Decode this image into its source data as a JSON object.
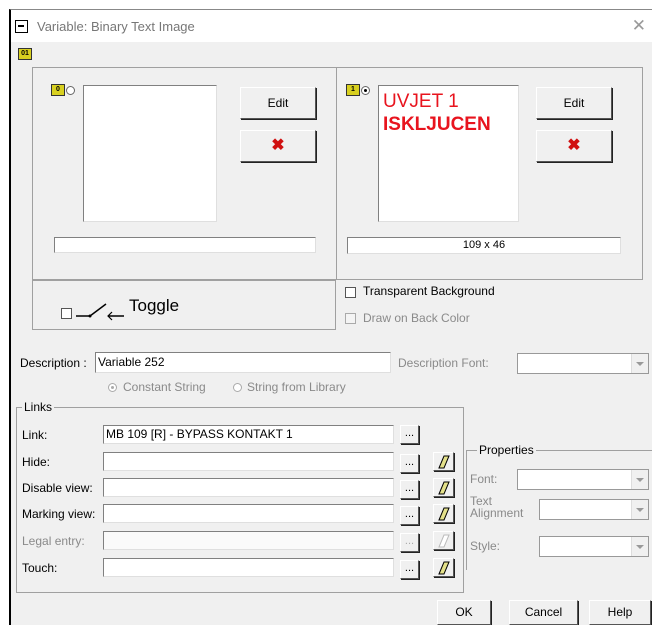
{
  "window": {
    "title": "Variable: Binary Text Image"
  },
  "state0": {
    "badge": "0",
    "edit_label": "Edit",
    "delete_glyph": "✖"
  },
  "state1": {
    "badge": "1",
    "text_lines": [
      "UVJET 1",
      "ISKLJUCEN"
    ],
    "size_text": "109 x 46",
    "edit_label": "Edit",
    "delete_glyph": "✖",
    "text_color": "#e8141e"
  },
  "toggle": {
    "label": "Toggle"
  },
  "options": {
    "transparent_bg": "Transparent Background",
    "draw_on_back_color": "Draw on Back Color"
  },
  "description": {
    "label": "Description :",
    "value": "Variable 252",
    "font_label": "Description Font:"
  },
  "source": {
    "constant": "Constant String",
    "library": "String from Library"
  },
  "links": {
    "group_label": "Links",
    "rows": [
      {
        "label": "Link:",
        "value": "MB 109 [R] - BYPASS KONTAKT 1",
        "eraser": false,
        "disabled": false
      },
      {
        "label": "Hide:",
        "value": "",
        "eraser": true,
        "disabled": false
      },
      {
        "label": "Disable view:",
        "value": "",
        "eraser": true,
        "disabled": false
      },
      {
        "label": "Marking view:",
        "value": "",
        "eraser": true,
        "disabled": false
      },
      {
        "label": "Legal entry:",
        "value": "",
        "eraser": true,
        "disabled": true
      },
      {
        "label": "Touch:",
        "value": "",
        "eraser": true,
        "disabled": false
      }
    ]
  },
  "properties": {
    "group_label": "Properties",
    "font_label": "Font:",
    "alignment_label": "Text Alignment",
    "style_label": "Style:"
  },
  "buttons": {
    "ok": "OK",
    "cancel": "Cancel",
    "help": "Help"
  }
}
